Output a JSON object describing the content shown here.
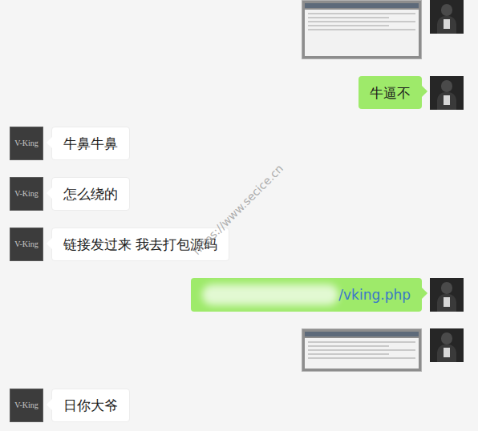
{
  "watermark": "https://www.secice.cn",
  "contact": {
    "avatar_label": "V-King"
  },
  "messages": [
    {
      "sender": "self",
      "kind": "image"
    },
    {
      "sender": "self",
      "kind": "text",
      "text": "牛逼不"
    },
    {
      "sender": "other",
      "kind": "text",
      "text": "牛鼻牛鼻"
    },
    {
      "sender": "other",
      "kind": "text",
      "text": "怎么绕的"
    },
    {
      "sender": "other",
      "kind": "text",
      "text": "链接发过来  我去打包源码"
    },
    {
      "sender": "self",
      "kind": "link",
      "text": "/vking.php"
    },
    {
      "sender": "self",
      "kind": "image"
    },
    {
      "sender": "other",
      "kind": "text",
      "text": "日你大爷"
    }
  ]
}
